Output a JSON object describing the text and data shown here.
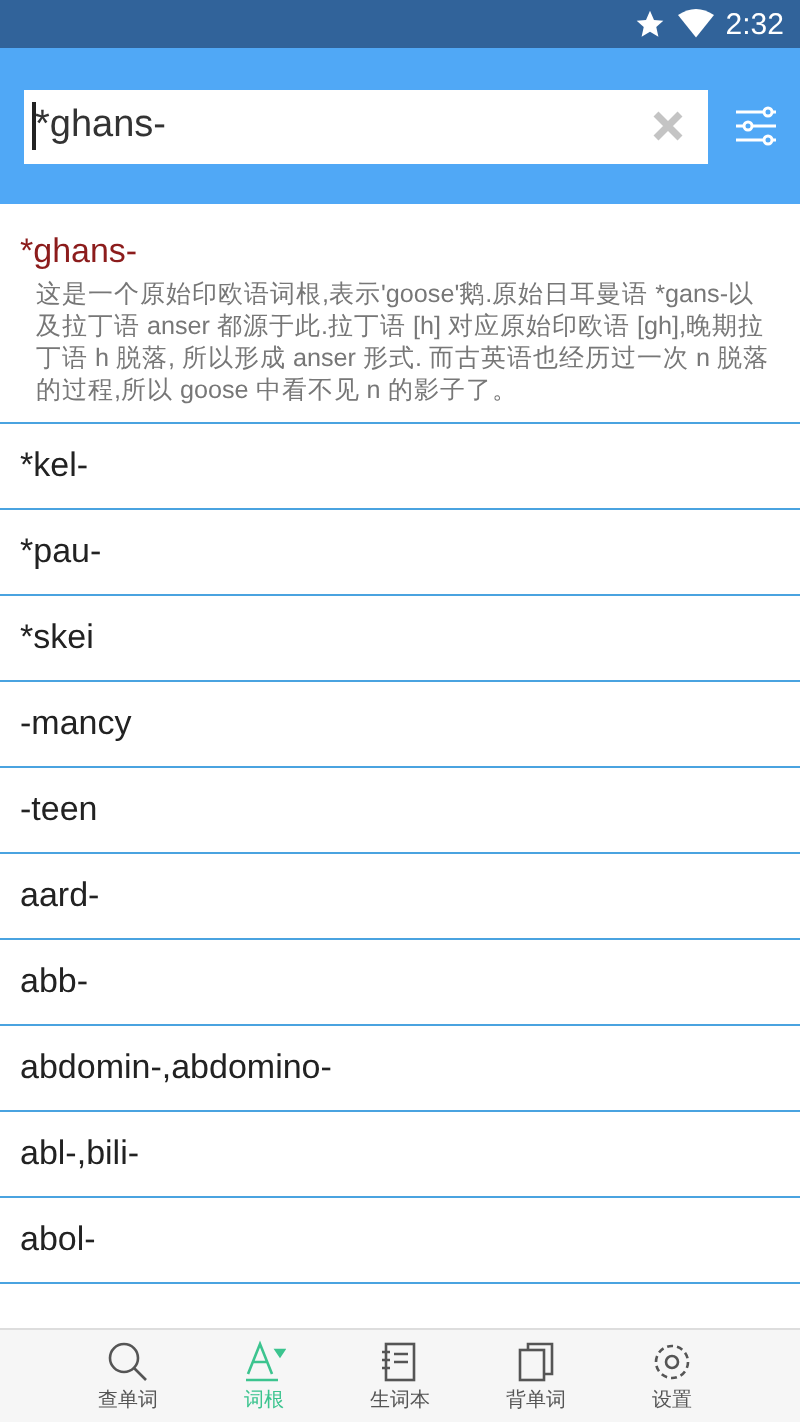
{
  "status_bar": {
    "time": "2:32"
  },
  "search": {
    "value": "*ghans-"
  },
  "expanded_entry": {
    "term": "*ghans-",
    "definition": "这是一个原始印欧语词根,表示'goose'鹅.原始日耳曼语 *gans-以及拉丁语 anser 都源于此.拉丁语 [h] 对应原始印欧语 [gh],晚期拉丁语 h 脱落, 所以形成 anser 形式. 而古英语也经历过一次 n 脱落的过程,所以 goose 中看不见 n 的影子了。"
  },
  "entries": [
    "*kel-",
    "*pau-",
    "*skei",
    "-mancy",
    "-teen",
    "aard-",
    "abb-",
    "abdomin-,abdomino-",
    "abl-,bili-",
    "abol-"
  ],
  "bottom_nav": [
    {
      "label": "查单词",
      "kind": "search",
      "selected": false
    },
    {
      "label": "词根",
      "kind": "root",
      "selected": true
    },
    {
      "label": "生词本",
      "kind": "notebook",
      "selected": false
    },
    {
      "label": "背单词",
      "kind": "cards",
      "selected": false
    },
    {
      "label": "设置",
      "kind": "settings",
      "selected": false
    }
  ]
}
